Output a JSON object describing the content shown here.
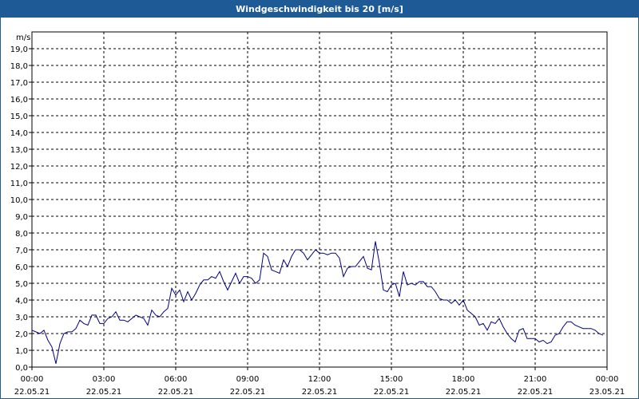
{
  "window": {
    "title": "Windgeschwindigkeit bis 20 [m/s]"
  },
  "colors": {
    "titlebar": "#1e5a96",
    "series": "#000080",
    "grid": "#000000"
  },
  "chart_data": {
    "type": "line",
    "title": "Windgeschwindigkeit bis 20 [m/s]",
    "ylabel": "m/s",
    "xlabel": "",
    "ylim": [
      0,
      20
    ],
    "xlim_hours": [
      0,
      24
    ],
    "y_ticks": [
      "0,0",
      "1,0",
      "2,0",
      "3,0",
      "4,0",
      "5,0",
      "6,0",
      "7,0",
      "8,0",
      "9,0",
      "10,0",
      "11,0",
      "12,0",
      "13,0",
      "14,0",
      "15,0",
      "16,0",
      "17,0",
      "18,0",
      "19,0"
    ],
    "x_ticks": [
      {
        "time": "00:00",
        "date": "22.05.21"
      },
      {
        "time": "03:00",
        "date": "22.05.21"
      },
      {
        "time": "06:00",
        "date": "22.05.21"
      },
      {
        "time": "09:00",
        "date": "22.05.21"
      },
      {
        "time": "12:00",
        "date": "22.05.21"
      },
      {
        "time": "15:00",
        "date": "22.05.21"
      },
      {
        "time": "18:00",
        "date": "22.05.21"
      },
      {
        "time": "21:00",
        "date": "22.05.21"
      },
      {
        "time": "00:00",
        "date": "23.05.21"
      }
    ],
    "grid": true,
    "series": [
      {
        "x": [
          "00:00",
          "00:20",
          "00:30",
          "00:40",
          "00:50",
          "01:00",
          "01:10",
          "01:20",
          "01:30",
          "01:40",
          "01:50",
          "02:00",
          "02:10",
          "02:20",
          "02:30",
          "02:40",
          "02:50",
          "03:00",
          "03:10",
          "03:20",
          "03:30",
          "03:40",
          "03:50",
          "04:00",
          "04:10",
          "04:20",
          "04:30",
          "04:40",
          "04:50",
          "05:00",
          "05:10",
          "05:20",
          "05:30",
          "05:40",
          "05:50",
          "06:00",
          "06:10",
          "06:20",
          "06:30",
          "06:40",
          "06:50",
          "07:00",
          "07:10",
          "07:20",
          "07:30",
          "07:40",
          "07:50",
          "08:00",
          "08:10",
          "08:20",
          "08:30",
          "08:40",
          "08:50",
          "09:00",
          "09:10",
          "09:20",
          "09:30",
          "09:40",
          "09:50",
          "10:00",
          "10:10",
          "10:20",
          "10:30",
          "10:40",
          "10:50",
          "11:00",
          "11:10",
          "11:20",
          "11:30",
          "11:40",
          "11:50",
          "12:00",
          "12:10",
          "12:20",
          "12:30",
          "12:40",
          "12:50",
          "13:00",
          "13:10",
          "13:20",
          "13:30",
          "13:40",
          "13:50",
          "14:00",
          "14:10",
          "14:20",
          "14:30",
          "14:40",
          "14:50",
          "15:00",
          "15:10",
          "15:20",
          "15:30",
          "15:40",
          "15:50",
          "16:00",
          "16:10",
          "16:20",
          "16:30",
          "16:40",
          "16:50",
          "17:00",
          "17:10",
          "17:20",
          "17:30",
          "17:40",
          "17:50",
          "18:00",
          "18:10",
          "18:20",
          "18:30",
          "18:40",
          "18:50",
          "19:00",
          "19:10",
          "19:20",
          "19:30",
          "19:40",
          "19:50",
          "20:00",
          "20:10",
          "20:20",
          "20:30",
          "20:40",
          "20:50",
          "21:00",
          "21:10",
          "21:20",
          "21:30",
          "21:40",
          "21:50",
          "22:00",
          "22:10",
          "22:20",
          "22:30",
          "22:40",
          "22:50",
          "23:00",
          "23:10",
          "23:20",
          "23:30",
          "23:40",
          "23:50"
        ],
        "values": [
          2.2,
          2.0,
          2.2,
          1.6,
          1.2,
          0.2,
          1.4,
          2.0,
          2.1,
          2.1,
          2.3,
          2.8,
          2.6,
          2.5,
          3.1,
          3.1,
          2.6,
          2.6,
          2.9,
          3.0,
          3.3,
          2.8,
          2.8,
          2.7,
          2.9,
          3.1,
          3.0,
          2.9,
          2.5,
          3.4,
          3.1,
          3.0,
          3.3,
          3.5,
          4.7,
          4.3,
          4.6,
          3.9,
          4.5,
          4.0,
          4.4,
          4.9,
          5.2,
          5.2,
          5.4,
          5.3,
          5.7,
          5.1,
          4.6,
          5.1,
          5.6,
          5.0,
          5.4,
          5.4,
          5.3,
          5.0,
          5.2,
          6.8,
          6.6,
          5.8,
          5.7,
          5.6,
          6.4,
          6.0,
          6.6,
          7.0,
          7.0,
          6.8,
          6.4,
          6.7,
          7.0,
          6.8,
          6.8,
          6.7,
          6.8,
          6.8,
          6.5,
          5.4,
          5.9,
          6.0,
          6.0,
          6.3,
          6.6,
          5.9,
          5.8,
          7.5,
          6.2,
          4.6,
          4.5,
          4.9,
          5.0,
          4.2,
          5.7,
          4.9,
          5.0,
          4.9,
          5.1,
          5.1,
          4.8,
          4.8,
          4.5,
          4.1,
          4.0,
          4.0,
          3.8,
          4.0,
          3.7,
          4.0,
          3.4,
          3.2,
          3.0,
          2.5,
          2.6,
          2.2,
          2.7,
          2.6,
          2.9,
          2.4,
          2.0,
          1.7,
          1.5,
          2.2,
          2.3,
          1.7,
          1.7,
          1.7,
          1.5,
          1.6,
          1.4,
          1.5,
          1.9,
          2.0,
          2.4,
          2.7,
          2.7,
          2.5,
          2.4,
          2.3,
          2.3,
          2.3,
          2.2,
          2.0,
          1.9
        ]
      }
    ]
  }
}
